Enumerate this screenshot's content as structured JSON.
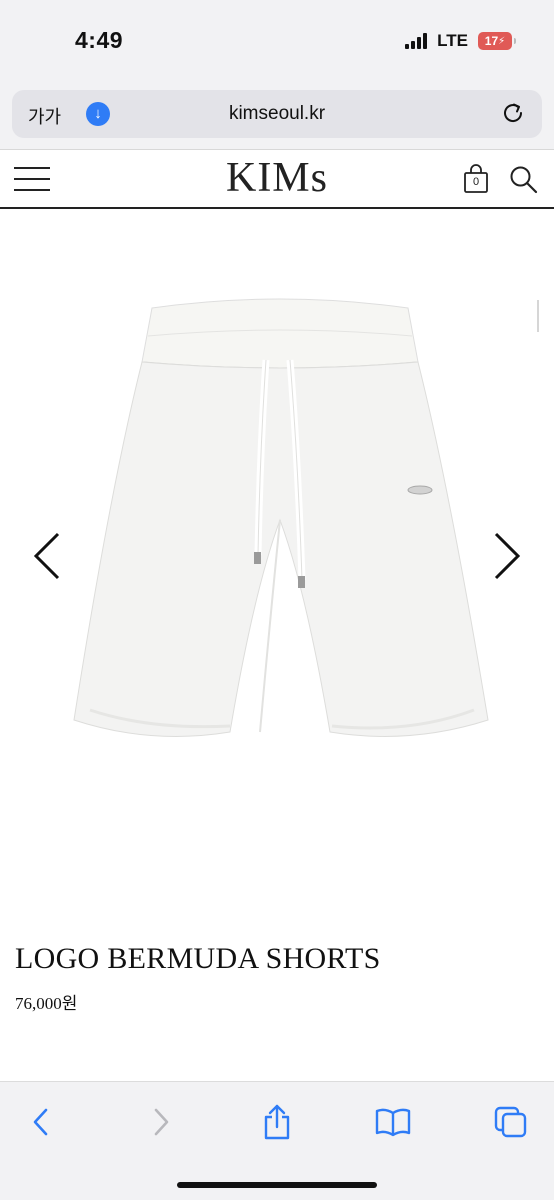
{
  "status": {
    "time": "4:49",
    "network": "LTE",
    "battery": "17"
  },
  "browser": {
    "text_size_label": "가가",
    "url": "kimseoul.kr"
  },
  "site": {
    "logo": "KIMs",
    "cart_count": "0"
  },
  "product": {
    "name": "LOGO BERMUDA SHORTS",
    "price": "76,000원"
  },
  "icons": {
    "menu": "hamburger-icon",
    "cart": "shopping-bag-icon",
    "search": "search-icon",
    "prev": "chevron-left-icon",
    "next": "chevron-right-icon",
    "back": "back-icon",
    "forward": "forward-icon",
    "share": "share-icon",
    "bookmarks": "book-icon",
    "tabs": "tabs-icon"
  },
  "colors": {
    "accent": "#2f7cf6",
    "battery": "#e05a56"
  }
}
